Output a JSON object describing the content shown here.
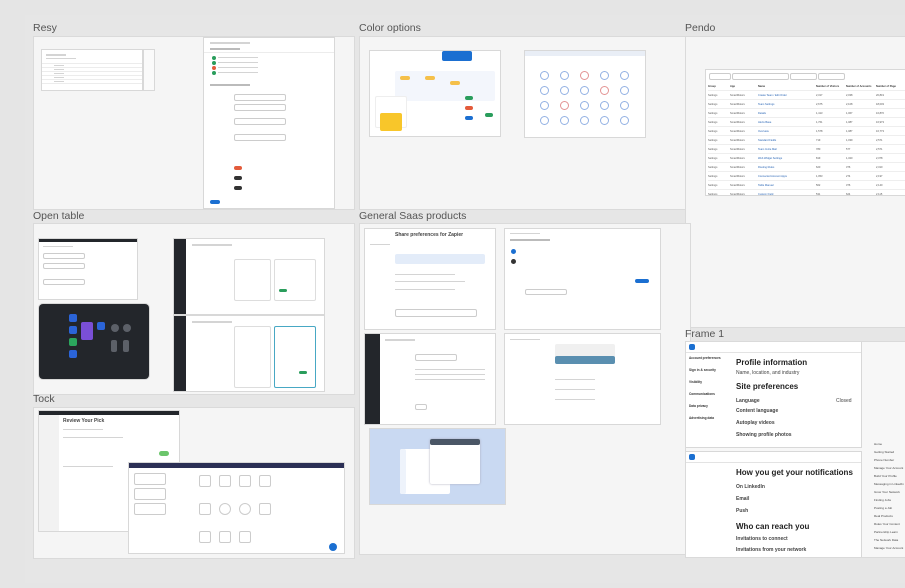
{
  "sections": {
    "resy": "Resy",
    "color_options": "Color options",
    "pendo": "Pendo",
    "open_table": "Open table",
    "general_saas": "General Saas products",
    "tock": "Tock",
    "frame1": "Frame 1"
  },
  "frame1": {
    "panel1": {
      "title": "Profile information",
      "sub": "Name, location, and industry",
      "site_prefs": "Site preferences",
      "language": "Language",
      "content_language": "Content language",
      "autoplay": "Autoplay videos",
      "showing_photos": "Showing profile photos",
      "nav_items": [
        "Account preferences",
        "Sign in & security",
        "Visibility",
        "Communications",
        "Data privacy",
        "Advertising data"
      ],
      "status": "Closed"
    },
    "panel2": {
      "title": "How you get your notifications",
      "on_linkedin": "On LinkedIn",
      "email": "Email",
      "push": "Push",
      "who_can_reach": "Who can reach you",
      "invitations": "Invitations to connect",
      "invitations_network": "Invitations from your network"
    },
    "side_list": [
      "Home",
      "Getting Started",
      "Phone Number",
      "Manage Your Account",
      "Build Your Profile",
      "Messaging in LinkedIn",
      "Grow Your Network",
      "Finding Jobs",
      "Posting a Job",
      "Real Products",
      "Rules Your Content",
      "Partnership Learn",
      "The Network Data",
      "Manage Your Account"
    ]
  },
  "pendo": {
    "columns": [
      "Group",
      "App",
      "Name",
      "Number of Visitors",
      "Number of Accounts",
      "Number of Page"
    ],
    "rows": [
      [
        "Settings",
        "SmartMotors",
        "Create Team / Edit Order",
        "2,317",
        "2,038",
        "20,819"
      ],
      [
        "Settings",
        "SmartMotors",
        "Team Settings",
        "2,675",
        "2,108",
        "18,003"
      ],
      [
        "Settings",
        "SmartMotors",
        "Details",
        "1,413",
        "1,067",
        "16,870"
      ],
      [
        "Settings",
        "SmartMotors",
        "Alerts Base",
        "1,761",
        "1,087",
        "16,973"
      ],
      [
        "Settings",
        "SmartMotors",
        "Overview",
        "1,578",
        "1,087",
        "16,773"
      ],
      [
        "Settings",
        "SmartMotors",
        "Standard Fields",
        "719",
        "1,039",
        "2,571"
      ],
      [
        "Settings",
        "SmartMotors",
        "Team Invite Mail",
        "780",
        "577",
        "2,571"
      ],
      [
        "Settings",
        "SmartMotors",
        "Web Widget Settings",
        "819",
        "1,320",
        "2,378"
      ],
      [
        "Settings",
        "SmartMotors",
        "Routing Rules",
        "620",
        "376",
        "2,310"
      ],
      [
        "Settings",
        "SmartMotors",
        "Connected Account Apps",
        "1,053",
        "274",
        "2,197"
      ],
      [
        "Settings",
        "SmartMotors",
        "Table Manual",
        "562",
        "376",
        "2,140"
      ],
      [
        "Settings",
        "SmartMotors",
        "Custom Field",
        "531",
        "624",
        "2,115"
      ],
      [
        "Settings",
        "SmartMotors",
        "Manage Program",
        "521",
        "435",
        "2,097"
      ]
    ]
  },
  "saas": {
    "dialog_title": "Share preferences for Zapier"
  },
  "tock": {
    "title": "Review Your Pick"
  },
  "colors": {
    "accent": "#1b6fd1",
    "board": "#e6e6e6",
    "panel": "#f5f5f5"
  }
}
